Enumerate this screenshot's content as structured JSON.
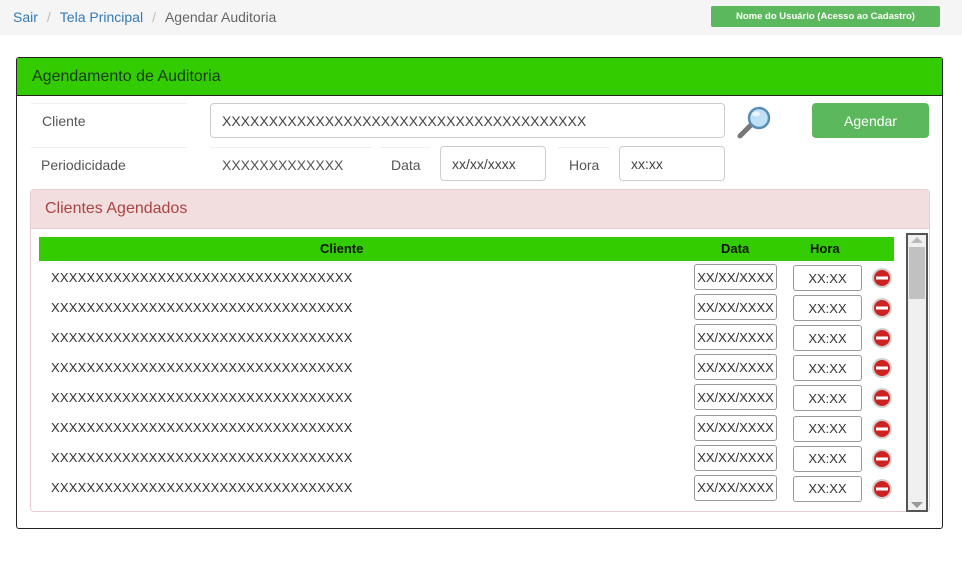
{
  "breadcrumb": {
    "items": [
      "Sair",
      "Tela Principal"
    ],
    "current": "Agendar Auditoria"
  },
  "user_button": "Nome do Usuário (Acesso ao Cadastro)",
  "panel": {
    "title": "Agendamento de Auditoria",
    "cliente_label": "Cliente",
    "cliente_value": "XXXXXXXXXXXXXXXXXXXXXXXXXXXXXXXXXXXXXXX",
    "periodicidade_label": "Periodicidade",
    "periodicidade_value": "XXXXXXXXXXXXX",
    "data_label": "Data",
    "data_value": "xx/xx/xxxx",
    "hora_label": "Hora",
    "hora_value": "xx:xx",
    "agendar_label": "Agendar"
  },
  "scheduled": {
    "title": "Clientes Agendados",
    "columns": [
      "Cliente",
      "Data",
      "Hora"
    ],
    "rows": [
      {
        "cliente": "XXXXXXXXXXXXXXXXXXXXXXXXXXXXXXXXXX",
        "data": "XX/XX/XXXX",
        "hora": "XX:XX"
      },
      {
        "cliente": "XXXXXXXXXXXXXXXXXXXXXXXXXXXXXXXXXX",
        "data": "XX/XX/XXXX",
        "hora": "XX:XX"
      },
      {
        "cliente": "XXXXXXXXXXXXXXXXXXXXXXXXXXXXXXXXXX",
        "data": "XX/XX/XXXX",
        "hora": "XX:XX"
      },
      {
        "cliente": "XXXXXXXXXXXXXXXXXXXXXXXXXXXXXXXXXX",
        "data": "XX/XX/XXXX",
        "hora": "XX:XX"
      },
      {
        "cliente": "XXXXXXXXXXXXXXXXXXXXXXXXXXXXXXXXXX",
        "data": "XX/XX/XXXX",
        "hora": "XX:XX"
      },
      {
        "cliente": "XXXXXXXXXXXXXXXXXXXXXXXXXXXXXXXXXX",
        "data": "XX/XX/XXXX",
        "hora": "XX:XX"
      },
      {
        "cliente": "XXXXXXXXXXXXXXXXXXXXXXXXXXXXXXXXXX",
        "data": "XX/XX/XXXX",
        "hora": "XX:XX"
      },
      {
        "cliente": "XXXXXXXXXXXXXXXXXXXXXXXXXXXXXXXXXX",
        "data": "XX/XX/XXXX",
        "hora": "XX:XX"
      }
    ]
  },
  "icons": {
    "search": "search-icon",
    "remove": "remove-icon"
  },
  "colors": {
    "header_green": "#33cc00",
    "button_green": "#5cb85c",
    "link_blue": "#337ab7",
    "danger_bg": "#f2dede",
    "danger_text": "#a94442",
    "remove_red": "#cc2222"
  }
}
